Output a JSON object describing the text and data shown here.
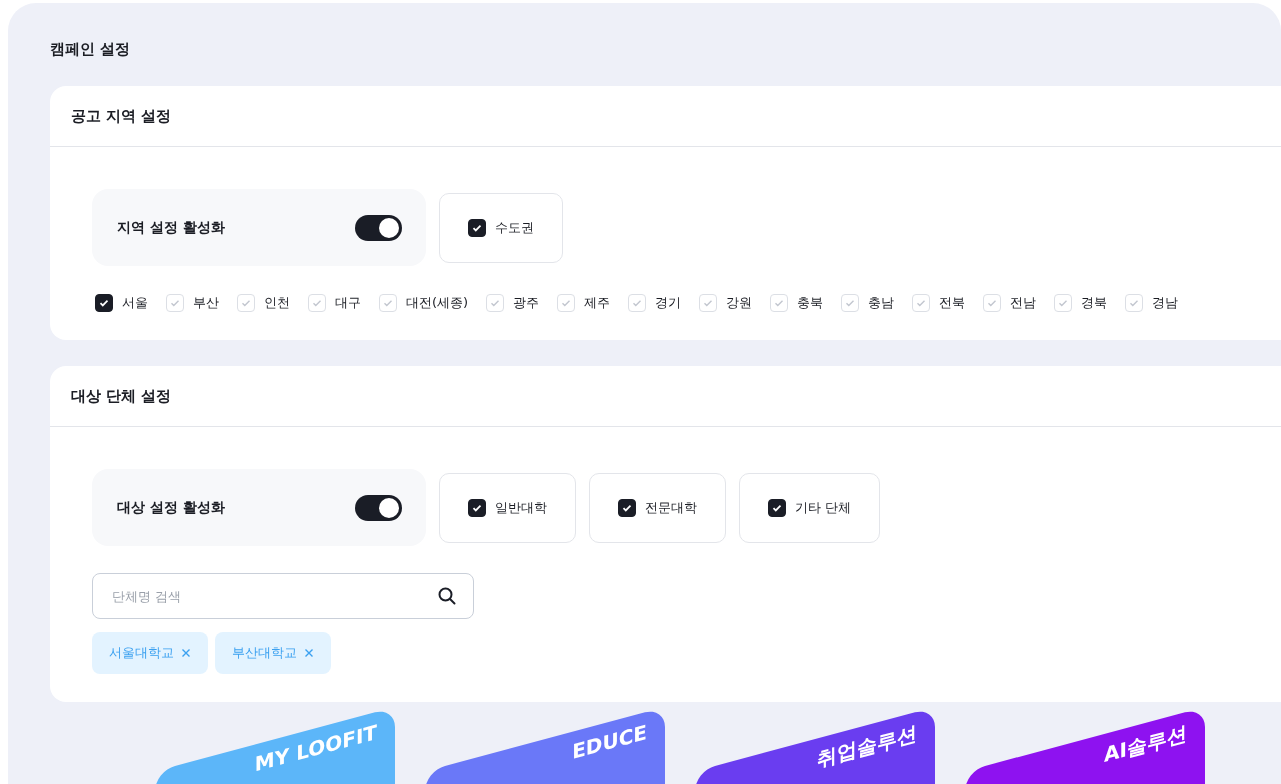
{
  "page_title": "캠페인 설정",
  "region_section": {
    "title": "공고 지역 설정",
    "toggle": {
      "label": "지역 설정 활성화",
      "on": true
    },
    "groups": [
      {
        "label": "수도권",
        "checked": true
      }
    ],
    "regions": [
      {
        "label": "서울",
        "checked": true
      },
      {
        "label": "부산",
        "checked": false
      },
      {
        "label": "인천",
        "checked": false
      },
      {
        "label": "대구",
        "checked": false
      },
      {
        "label": "대전(세종)",
        "checked": false
      },
      {
        "label": "광주",
        "checked": false
      },
      {
        "label": "제주",
        "checked": false
      },
      {
        "label": "경기",
        "checked": false
      },
      {
        "label": "강원",
        "checked": false
      },
      {
        "label": "충북",
        "checked": false
      },
      {
        "label": "충남",
        "checked": false
      },
      {
        "label": "전북",
        "checked": false
      },
      {
        "label": "전남",
        "checked": false
      },
      {
        "label": "경북",
        "checked": false
      },
      {
        "label": "경남",
        "checked": false
      }
    ]
  },
  "target_section": {
    "title": "대상 단체 설정",
    "toggle": {
      "label": "대상 설정 활성화",
      "on": true
    },
    "groups": [
      {
        "label": "일반대학",
        "checked": true
      },
      {
        "label": "전문대학",
        "checked": true
      },
      {
        "label": "기타 단체",
        "checked": true
      }
    ],
    "search": {
      "placeholder": "단체명 검색"
    },
    "tags": [
      "서울대학교",
      "부산대학교"
    ]
  },
  "banners": [
    {
      "label": "MY LOOFIT",
      "color": "#5cb6f9"
    },
    {
      "label": "EDUCE",
      "color": "#6a78f8"
    },
    {
      "label": "취업솔루션",
      "color": "#6a3df0"
    },
    {
      "label": "AI솔루션",
      "color": "#8e12f0"
    }
  ]
}
